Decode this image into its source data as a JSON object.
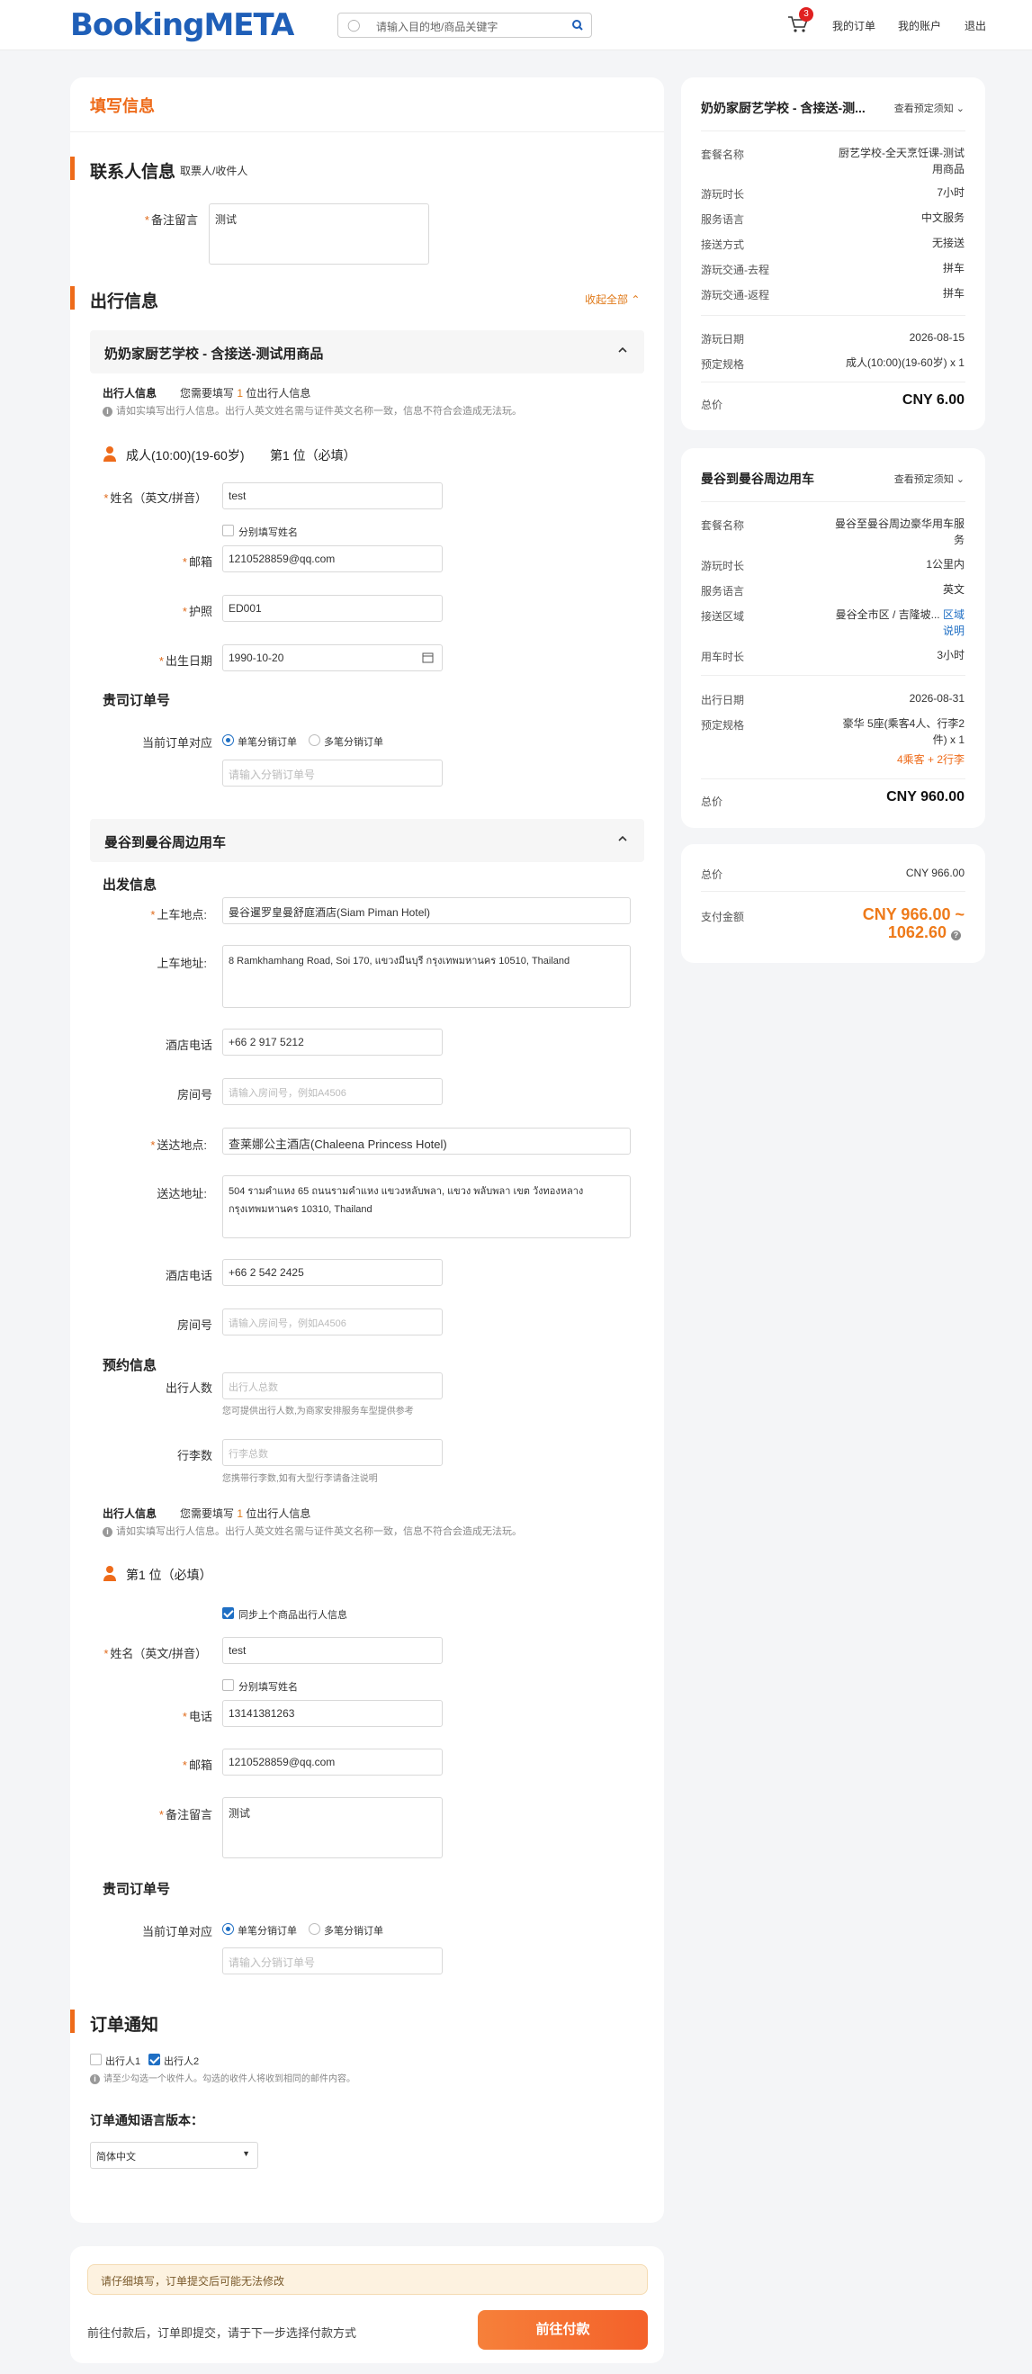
{
  "header": {
    "logo": "BookingMETA",
    "search_placeholder": "请输入目的地/商品关键字",
    "cart_count": "3",
    "nav": [
      "我的订单",
      "我的账户",
      "退出"
    ]
  },
  "page": {
    "title": "填写信息"
  },
  "contact": {
    "title": "联系人信息",
    "subtitle": "取票人/收件人",
    "remark_label": "备注留言",
    "remark_value": "测试"
  },
  "travel": {
    "title": "出行信息",
    "collapse_all": "收起全部"
  },
  "product1": {
    "title": "奶奶家厨艺学校 - 含接送-测试用商品",
    "traveler_info_label": "出行人信息",
    "need_prefix": "您需要填写",
    "need_count": "1",
    "need_suffix": "位出行人信息",
    "note": "请如实填写出行人信息。出行人英文姓名需与证件英文名称一致，信息不符合会造成无法玩。",
    "person_title": "成人(10:00)(19-60岁)",
    "person_index": "第1 位（必填）",
    "name_label": "姓名（英文/拼音）",
    "name_value": "test",
    "split_name": "分别填写姓名",
    "email_label": "邮箱",
    "email_value": "1210528859@qq.com",
    "passport_label": "护照",
    "passport_value": "ED001",
    "dob_label": "出生日期",
    "dob_value": "1990-10-20",
    "order_no_title": "贵司订单号",
    "order_mode_label": "当前订单对应",
    "radio1": "单笔分销订单",
    "radio2": "多笔分销订单",
    "order_no_placeholder": "请输入分销订单号"
  },
  "product2": {
    "title": "曼谷到曼谷周边用车",
    "depart_title": "出发信息",
    "pickup_label": "上车地点:",
    "pickup_value": "曼谷暹罗皇曼舒庭酒店(Siam Piman Hotel)",
    "pickup_addr_label": "上车地址:",
    "pickup_addr_value": "8 Ramkhamhang Road, Soi 170, แขวงมีนบุรี กรุงเทพมหานคร 10510, Thailand",
    "hotel_phone_label": "酒店电话",
    "hotel_phone1": "+66 2 917 5212",
    "room_label": "房间号",
    "room_placeholder": "请输入房间号，例如A4506",
    "dropoff_label": "送达地点:",
    "dropoff_value": "查莱娜公主酒店(Chaleena Princess Hotel)",
    "dropoff_addr_label": "送达地址:",
    "dropoff_addr_value": "504 รามคำแหง 65 ถนนรามคำแหง แขวงหลับพลา, แขวง พลับพลา เขต วังทองหลาง กรุงเทพมหานคร 10310, Thailand",
    "hotel_phone2": "+66 2 542 2425",
    "booking_title": "预约信息",
    "pax_label": "出行人数",
    "pax_placeholder": "出行人总数",
    "pax_note": "您可提供出行人数,为商家安排服务车型提供参考",
    "bag_label": "行李数",
    "bag_placeholder": "行李总数",
    "bag_note": "您携带行李数,如有大型行李请备注说明",
    "traveler_info_label": "出行人信息",
    "need_prefix": "您需要填写",
    "need_count": "1",
    "need_suffix": "位出行人信息",
    "note": "请如实填写出行人信息。出行人英文姓名需与证件英文名称一致，信息不符合会造成无法玩。",
    "person_index": "第1 位（必填）",
    "sync_label": "同步上个商品出行人信息",
    "name_label": "姓名（英文/拼音）",
    "name_value": "test",
    "split_name": "分别填写姓名",
    "phone_label": "电话",
    "phone_value": "13141381263",
    "email_label": "邮箱",
    "email_value": "1210528859@qq.com",
    "remark_label": "备注留言",
    "remark_value": "测试",
    "order_no_title": "贵司订单号",
    "order_mode_label": "当前订单对应",
    "radio1": "单笔分销订单",
    "radio2": "多笔分销订单",
    "order_no_placeholder": "请输入分销订单号"
  },
  "notify": {
    "title": "订单通知",
    "opt1": "出行人1",
    "opt2": "出行人2",
    "note": "请至少勾选一个收件人。勾选的收件人将收到相同的邮件内容。",
    "lang_title": "订单通知语言版本：",
    "lang_value": "简体中文"
  },
  "footer": {
    "warning": "请仔细填写，订单提交后可能无法修改",
    "hint": "前往付款后，订单即提交，请于下一步选择付款方式",
    "pay_button": "前往付款"
  },
  "summary1": {
    "title": "奶奶家厨艺学校 - 含接送-测...",
    "link": "查看预定须知",
    "rows": [
      [
        "套餐名称",
        "厨艺学校-全天烹饪课-测试用商品"
      ],
      [
        "游玩时长",
        "7小时"
      ],
      [
        "服务语言",
        "中文服务"
      ],
      [
        "接送方式",
        "无接送"
      ],
      [
        "游玩交通-去程",
        "拼车"
      ],
      [
        "游玩交通-返程",
        "拼车"
      ]
    ],
    "date_label": "游玩日期",
    "date_value": "2026-08-15",
    "spec_label": "预定规格",
    "spec_value": "成人(10:00)(19-60岁) x 1",
    "total_label": "总价",
    "total_value": "CNY 6.00"
  },
  "summary2": {
    "title": "曼谷到曼谷周边用车",
    "link": "查看预定须知",
    "pkg_label": "套餐名称",
    "pkg_value": "曼谷至曼谷周边豪华用车服务",
    "dur_label": "游玩时长",
    "dur_value": "1公里内",
    "lang_label": "服务语言",
    "lang_value": "英文",
    "area_label": "接送区域",
    "area_value": "曼谷全市区 / 吉隆坡...",
    "area_link": "区域说明",
    "use_label": "用车时长",
    "use_value": "3小时",
    "date_label": "出行日期",
    "date_value": "2026-08-31",
    "spec_label": "预定规格",
    "spec_value": "豪华 5座(乘客4人、行李2件) x 1",
    "spec_extra": "4乘客 + 2行李",
    "total_label": "总价",
    "total_value": "CNY 960.00"
  },
  "summary3": {
    "total_label": "总价",
    "total_value": "CNY 966.00",
    "pay_label": "支付金额",
    "pay_value1": "CNY 966.00 ~",
    "pay_value2": "1062.60"
  },
  "colors": {
    "brand": "#1f5fb8",
    "accent": "#ee6b1a",
    "link": "#1f6fc4"
  }
}
